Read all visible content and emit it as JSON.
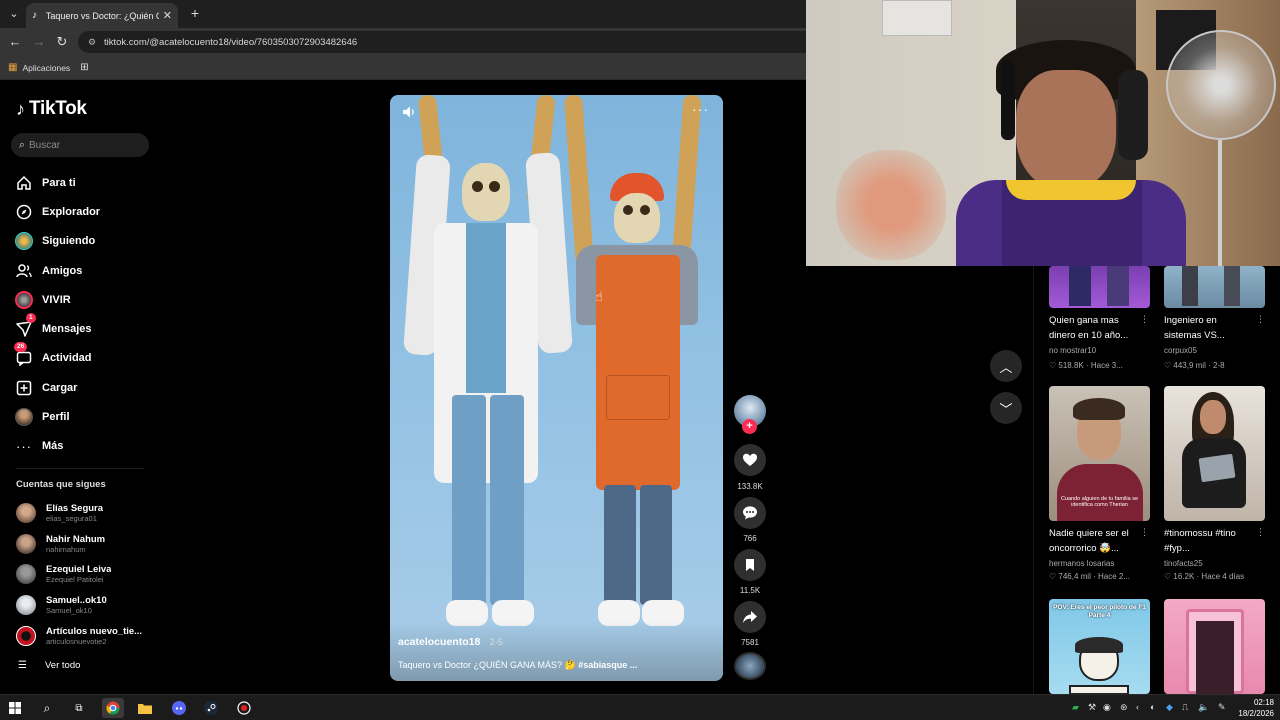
{
  "browser": {
    "tab_title": "Taquero vs Doctor: ¿Quién Gana...",
    "url": "tiktok.com/@acatelocuento18/video/7603503072903482646",
    "bookmark_apps": "Aplicaciones"
  },
  "sidebar": {
    "logo": "TikTok",
    "search_placeholder": "Buscar",
    "nav": [
      {
        "label": "Para ti",
        "icon": "home-icon",
        "badge": ""
      },
      {
        "label": "Explorador",
        "icon": "compass-icon",
        "badge": ""
      },
      {
        "label": "Siguiendo",
        "icon": "following-avatar-icon",
        "badge": ""
      },
      {
        "label": "Amigos",
        "icon": "friends-icon",
        "badge": ""
      },
      {
        "label": "VIVIR",
        "icon": "live-icon",
        "badge": ""
      },
      {
        "label": "Mensajes",
        "icon": "messages-icon",
        "badge": "1"
      },
      {
        "label": "Actividad",
        "icon": "activity-icon",
        "badge": "26"
      },
      {
        "label": "Cargar",
        "icon": "upload-icon",
        "badge": ""
      },
      {
        "label": "Perfil",
        "icon": "profile-avatar-icon",
        "badge": ""
      },
      {
        "label": "Más",
        "icon": "more-icon",
        "badge": ""
      }
    ],
    "following_title": "Cuentas que sigues",
    "following": [
      {
        "name": "Elías Segura",
        "handle": "elias_segura01",
        "color": "#8a6e54"
      },
      {
        "name": "Nahir Nahum",
        "handle": "nahirnahum",
        "color": "#6d5a4c"
      },
      {
        "name": "Ezequiel Leiva",
        "handle": "Ezequiel Patitolei",
        "color": "#7a7a7a"
      },
      {
        "name": "Samuel..ok10",
        "handle": "Samuel_ok10",
        "color": "#b6b8bd"
      },
      {
        "name": "Artículos nuevo_tie...",
        "handle": "articulosnuevotie2",
        "color": "#c2121f"
      }
    ],
    "see_all": "Ver todo"
  },
  "video": {
    "author": "acatelocuento18",
    "date": "· 2-5",
    "caption": "Taquero vs Doctor ¿QUIÉN GANA MÁS? 🤔",
    "caption_tag": "#sabiasque ..."
  },
  "actions": {
    "likes": "133.8K",
    "comments": "766",
    "saves": "11.5K",
    "shares": "7581"
  },
  "recommended": [
    {
      "title": "Quien gana mas dinero en 10 año...",
      "author": "no mostrar10",
      "meta": "♡ 518.8K · Hace 3..."
    },
    {
      "title": "Ingeniero en sistemas VS...",
      "author": "corpux05",
      "meta": "♡ 443,9 mil · 2-8"
    },
    {
      "title": "Nadie quiere ser el oncorrorico 🤯...",
      "author": "hermanos losarias",
      "meta": "♡ 746,4 mil · Hace 2..."
    },
    {
      "title": "#tinomossu #tino #fyp...",
      "author": "tinofacts25",
      "meta": "♡ 16.2K · Hace 4 días"
    },
    {
      "title": "",
      "author": "",
      "meta": "",
      "thumb_text": "POV: Eres el peor piloto de F1 Parte 4"
    },
    {
      "title": "",
      "author": "",
      "meta": ""
    }
  ],
  "thumb_overlay": "Cuando alguien de tu familia se identifica como Therian",
  "taskbar": {
    "time": "02:18",
    "date": "18/2/2026"
  }
}
